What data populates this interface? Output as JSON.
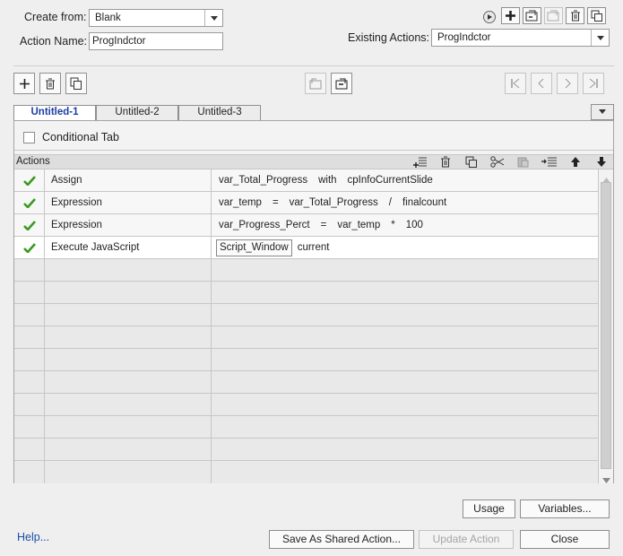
{
  "header": {
    "create_from_label": "Create from:",
    "create_from_value": "Blank",
    "action_name_label": "Action Name:",
    "action_name_value": "ProgIndctor",
    "existing_actions_label": "Existing Actions:",
    "existing_actions_value": "ProgIndctor"
  },
  "tabs": [
    {
      "label": "Untitled-1",
      "active": true
    },
    {
      "label": "Untitled-2",
      "active": false
    },
    {
      "label": "Untitled-3",
      "active": false
    }
  ],
  "conditional_tab_label": "Conditional Tab",
  "actions_label": "Actions",
  "rows": [
    {
      "action": "Assign",
      "tokens": [
        "var_Total_Progress",
        "with",
        "cpInfoCurrentSlide"
      ]
    },
    {
      "action": "Expression",
      "tokens": [
        "var_temp",
        "=",
        "var_Total_Progress",
        "/",
        "finalcount"
      ]
    },
    {
      "action": "Expression",
      "tokens": [
        "var_Progress_Perct",
        "=",
        "var_temp",
        "*",
        "100"
      ]
    },
    {
      "action": "Execute JavaScript",
      "chip": "Script_Window",
      "tokens": [
        "current"
      ]
    }
  ],
  "buttons": {
    "usage": "Usage",
    "variables": "Variables...",
    "help": "Help...",
    "save_shared": "Save As Shared Action...",
    "update_action": "Update Action",
    "close": "Close"
  },
  "colors": {
    "accent": "#1b3fa3",
    "check": "#3a9a1f",
    "link": "#1c4ea6"
  }
}
